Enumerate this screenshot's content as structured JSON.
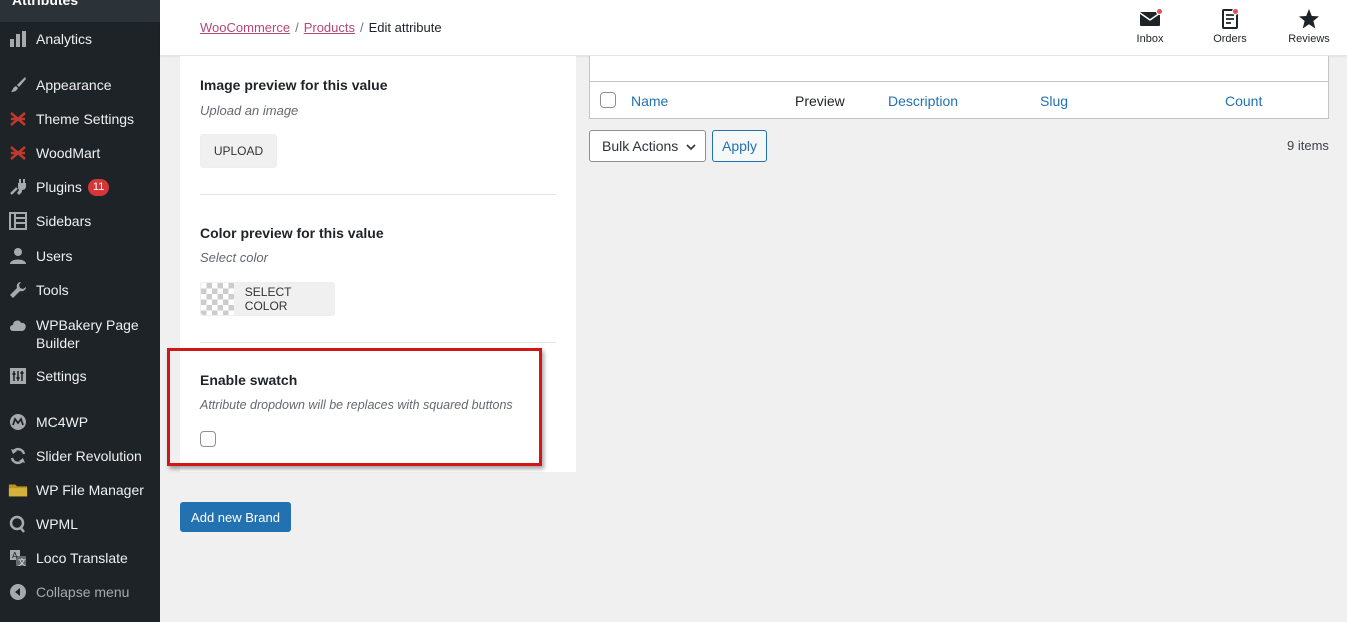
{
  "sidebar": {
    "top_label": "Attributes",
    "items": [
      {
        "key": "analytics",
        "label": "Analytics",
        "icon": "bar-chart-icon"
      },
      {
        "key": "appearance",
        "label": "Appearance",
        "icon": "paintbrush-icon"
      },
      {
        "key": "theme-settings",
        "label": "Theme Settings",
        "icon": "woodmart-icon"
      },
      {
        "key": "woodmart",
        "label": "WoodMart",
        "icon": "woodmart-icon"
      },
      {
        "key": "plugins",
        "label": "Plugins",
        "icon": "plug-icon",
        "badge": "11"
      },
      {
        "key": "sidebars",
        "label": "Sidebars",
        "icon": "grid-icon"
      },
      {
        "key": "users",
        "label": "Users",
        "icon": "user-icon"
      },
      {
        "key": "tools",
        "label": "Tools",
        "icon": "wrench-icon"
      },
      {
        "key": "wpbakery",
        "label": "WPBakery Page\nBuilder",
        "label_line1": "WPBakery Page",
        "label_line2": "Builder",
        "icon": "cloud-icon"
      },
      {
        "key": "settings",
        "label": "Settings",
        "icon": "sliders-icon"
      },
      {
        "key": "mc4wp",
        "label": "MC4WP",
        "icon": "mc4wp-icon"
      },
      {
        "key": "slider-revolution",
        "label": "Slider Revolution",
        "icon": "refresh-icon"
      },
      {
        "key": "wp-file-manager",
        "label": "WP File Manager",
        "icon": "folder-icon"
      },
      {
        "key": "wpml",
        "label": "WPML",
        "icon": "wpml-icon"
      },
      {
        "key": "loco-translate",
        "label": "Loco Translate",
        "icon": "translate-icon"
      },
      {
        "key": "collapse",
        "label": "Collapse menu",
        "icon": "collapse-icon"
      }
    ]
  },
  "header": {
    "breadcrumb": {
      "woocommerce": "WooCommerce",
      "products": "Products",
      "current": "Edit attribute",
      "sep": "/"
    },
    "inbox_label": "Inbox",
    "orders_label": "Orders",
    "reviews_label": "Reviews"
  },
  "form": {
    "image_title": "Image preview for this value",
    "image_desc": "Upload an image",
    "upload_label": "UPLOAD",
    "color_title": "Color preview for this value",
    "color_desc": "Select color",
    "select_color_label": "SELECT COLOR",
    "swatch_title": "Enable swatch",
    "swatch_desc": "Attribute dropdown will be replaces with squared buttons",
    "add_button": "Add new Brand"
  },
  "table": {
    "columns": {
      "name": "Name",
      "preview": "Preview",
      "description": "Description",
      "slug": "Slug",
      "count": "Count"
    },
    "bulk_actions": "Bulk Actions",
    "apply": "Apply",
    "items_count": "9 items"
  },
  "colors": {
    "sidebar_bg": "#1d2327",
    "accent_blue": "#2271b1",
    "breadcrumb_link": "#b5477b",
    "highlight_red": "#d01616",
    "badge_red": "#d63638"
  }
}
